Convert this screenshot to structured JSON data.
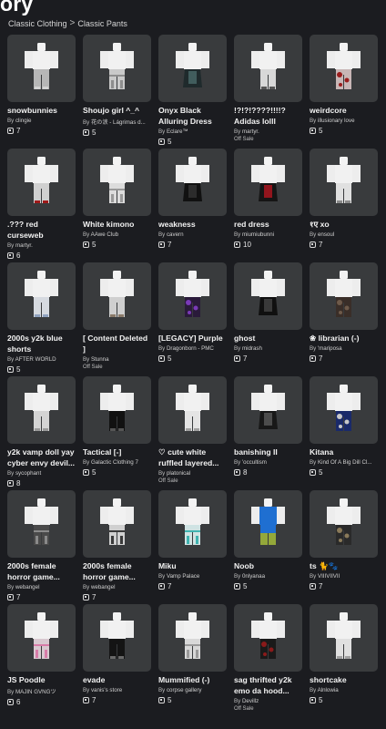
{
  "header": {
    "title": "ory",
    "breadcrumb": [
      "Classic Clothing",
      "Classic Pants"
    ],
    "separator": ">"
  },
  "items": [
    {
      "name": "snowbunnies",
      "creator": "clingie",
      "price": "7",
      "offsale": "",
      "color": "#b7b7b7",
      "accent": "#d3d3d3",
      "pattern": "plain"
    },
    {
      "name": "Shoujo girl ^_^",
      "creator": "花の涙 - Lágrimas d...",
      "price": "5",
      "offsale": "",
      "color": "#c9c9c9",
      "accent": "#8e8e8e",
      "pattern": "stripes"
    },
    {
      "name": "Onyx Black Alluring Dress",
      "creator": "Eclare™",
      "price": "5",
      "offsale": "",
      "color": "#1f2a2c",
      "accent": "#4a6a6a",
      "pattern": "dress"
    },
    {
      "name": "!?!?!????!!!!? Adidas lolll",
      "creator": "martyr.",
      "price": "",
      "offsale": "Off Sale",
      "color": "#d8d8d8",
      "accent": "#555555",
      "pattern": "plain"
    },
    {
      "name": "weirdcore",
      "creator": "illusionary love",
      "price": "5",
      "offsale": "",
      "color": "#c8b6b6",
      "accent": "#9a1c1c",
      "pattern": "splatter"
    },
    {
      "name": ".??? red curseweb weirdcore",
      "creator": "martyr.",
      "price": "6",
      "offsale": "",
      "color": "#d0d0d0",
      "accent": "#9e1a1a",
      "pattern": "plain"
    },
    {
      "name": "White kimono",
      "creator": "AAwe Club",
      "price": "5",
      "offsale": "",
      "color": "#dcdcdc",
      "accent": "#9a9a9a",
      "pattern": "stripes"
    },
    {
      "name": "weakness",
      "creator": "cavern",
      "price": "7",
      "offsale": "",
      "color": "#111111",
      "accent": "#333333",
      "pattern": "dress"
    },
    {
      "name": "red dress",
      "creator": "miumiubunni",
      "price": "10",
      "offsale": "",
      "color": "#151515",
      "accent": "#b2151f",
      "pattern": "dress"
    },
    {
      "name": "१ए xo",
      "creator": "ensoul",
      "price": "7",
      "offsale": "",
      "color": "#e0e0e0",
      "accent": "#8a8a8a",
      "pattern": "plain"
    },
    {
      "name": "2000s y2k blue shorts",
      "creator": "AFTER WORLD",
      "price": "5",
      "offsale": "",
      "color": "#d6dae0",
      "accent": "#8fa2bf",
      "pattern": "plain"
    },
    {
      "name": "[ Content Deleted ]",
      "creator": "Stunna",
      "price": "",
      "offsale": "Off Sale",
      "color": "#cfcfcf",
      "accent": "#8a7a6a",
      "pattern": "plain"
    },
    {
      "name": "[LEGACY] Purple",
      "creator": "Dragonborn - PMC",
      "price": "5",
      "offsale": "",
      "color": "#2a1a3a",
      "accent": "#7a3ab8",
      "pattern": "splatter"
    },
    {
      "name": "ghost",
      "creator": "midrash",
      "price": "7",
      "offsale": "",
      "color": "#101010",
      "accent": "#444444",
      "pattern": "dress"
    },
    {
      "name": "❀ librarian (-)",
      "creator": "'mariposa",
      "price": "7",
      "offsale": "",
      "color": "#3a2e28",
      "accent": "#6e5a4a",
      "pattern": "splatter"
    },
    {
      "name": "y2k vamp doll yay cyber envy devil...",
      "creator": "sycophant",
      "price": "8",
      "offsale": "",
      "color": "#d4d4d4",
      "accent": "#999999",
      "pattern": "plain"
    },
    {
      "name": "Tactical [-]",
      "creator": "Galactic Clothing 7",
      "price": "5",
      "offsale": "",
      "color": "#111111",
      "accent": "#555555",
      "pattern": "plain"
    },
    {
      "name": "♡ cute white ruffled layered...",
      "creator": "platonical",
      "price": "",
      "offsale": "Off Sale",
      "color": "#e4e4e4",
      "accent": "#a0a0a0",
      "pattern": "plain"
    },
    {
      "name": "banishing II",
      "creator": "'occultism",
      "price": "8",
      "offsale": "",
      "color": "#181818",
      "accent": "#5a5a5a",
      "pattern": "dress"
    },
    {
      "name": "Kitana",
      "creator": "Kind Of A Big Dill Cl...",
      "price": "5",
      "offsale": "",
      "color": "#1a2a6a",
      "accent": "#c8c8c8",
      "pattern": "splatter"
    },
    {
      "name": "2000s female horror game...",
      "creator": "webangel",
      "price": "7",
      "offsale": "",
      "color": "#4a4a4a",
      "accent": "#8a8a8a",
      "pattern": "stripes"
    },
    {
      "name": "2000s female horror game...",
      "creator": "webangel",
      "price": "7",
      "offsale": "",
      "color": "#d0d0d0",
      "accent": "#3a3a3a",
      "pattern": "stripes"
    },
    {
      "name": "Miku",
      "creator": "Vamp Palace",
      "price": "7",
      "offsale": "",
      "color": "#cfe3e3",
      "accent": "#3fb3b0",
      "pattern": "stripes"
    },
    {
      "name": "Noob",
      "creator": "0nlyanaa",
      "price": "5",
      "offsale": "",
      "color": "#1f6fd1",
      "accent": "#94a83a",
      "pattern": "noob"
    },
    {
      "name": "ts 🐈🐾",
      "creator": "VIIIVIIVII",
      "price": "7",
      "offsale": "",
      "color": "#2a2a2a",
      "accent": "#8a7a5a",
      "pattern": "splatter"
    },
    {
      "name": "JS Poodle",
      "creator": "MAJIN GVNGツ",
      "price": "6",
      "offsale": "",
      "color": "#d8c8d0",
      "accent": "#d77ba8",
      "pattern": "stripes"
    },
    {
      "name": "evade",
      "creator": "vanis's store",
      "price": "7",
      "offsale": "",
      "color": "#141414",
      "accent": "#6a6a6a",
      "pattern": "plain"
    },
    {
      "name": "Mummified (-)",
      "creator": "corpse gallery",
      "price": "5",
      "offsale": "",
      "color": "#d8d8d8",
      "accent": "#9a9a9a",
      "pattern": "stripes"
    },
    {
      "name": "sag thrifted y2k emo da hood...",
      "creator": "Devillz",
      "price": "",
      "offsale": "Off Sale",
      "color": "#1a1a1a",
      "accent": "#8a1a1a",
      "pattern": "splatter"
    },
    {
      "name": "shortcake",
      "creator": "Alnlowia",
      "price": "5",
      "offsale": "",
      "color": "#e0e0e0",
      "accent": "#a0a0a0",
      "pattern": "plain"
    }
  ]
}
